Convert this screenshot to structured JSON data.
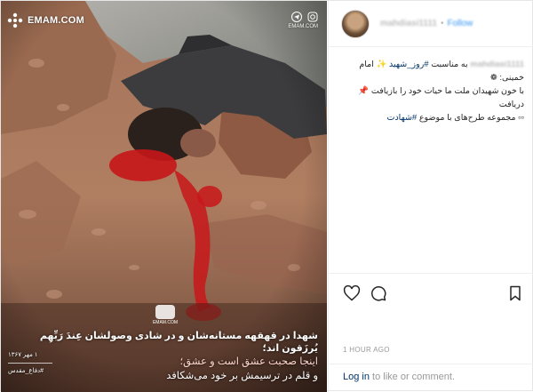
{
  "brand": {
    "name": "EMAM.COM"
  },
  "social": {
    "handle": "EMAM.COM"
  },
  "image": {
    "seal_text": "EMAM.COM",
    "caption_line1": "شهدا در قهقهه مستانه‌شان و در شادی وصولشان عِندَ رَبِّهِم یُرزَقون اند؛",
    "caption_line2": "اینجا صحبت عشق است و عشق؛",
    "caption_line3": "و قلم در ترسیمش بر خود می‌شکافد",
    "date": "۱ مهر ۱۳۶۷",
    "hashtag": "#دفاع_مقدس"
  },
  "header": {
    "username": "mahdiasi1111",
    "separator": "•",
    "follow_label": "Follow"
  },
  "post": {
    "comment_user": "mahdiasi1111",
    "comment_text_1": "به مناسبت",
    "comment_tag_1": "#روز_شهید",
    "comment_text_2": "امام خمینی:",
    "comment_text_3": "با خون شهیدان ملت ما حیات خود را بازیافت",
    "comment_text_4": "دریافت",
    "comment_text_5": "مجموعه طرح‌های با موضوع",
    "comment_tag_2": "#شهادت",
    "timestamp": "1 HOUR AGO"
  },
  "footer": {
    "login_link": "Log in",
    "rest": " to like or comment."
  },
  "icons": {
    "like": "heart-icon",
    "comment": "comment-icon",
    "bookmark": "bookmark-icon"
  },
  "colors": {
    "link": "#003569",
    "follow": "#3897f0",
    "muted": "#999999",
    "blood": "#c8161a"
  }
}
